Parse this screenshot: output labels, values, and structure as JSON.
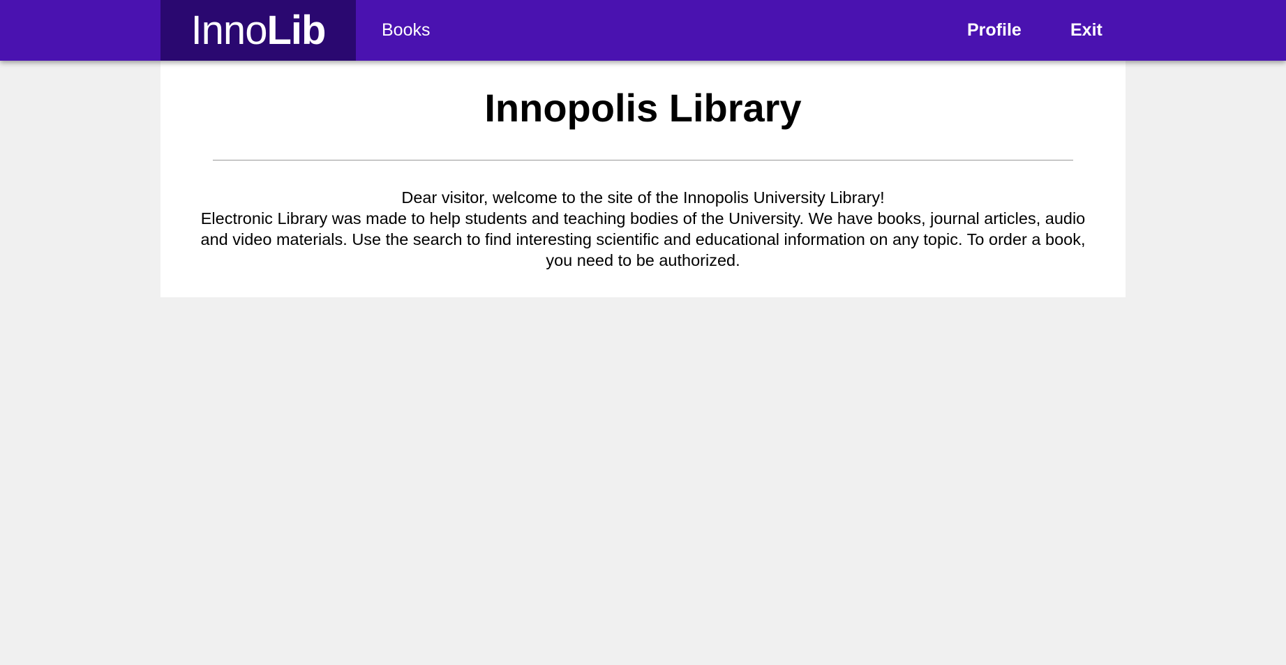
{
  "navbar": {
    "brand_light": "Inno",
    "brand_bold": "Lib",
    "books_label": "Books",
    "profile_label": "Profile",
    "exit_label": "Exit",
    "colors": {
      "bar": "#4a12b0",
      "brand_bg": "#2a0870",
      "text": "#ffffff"
    }
  },
  "main": {
    "title": "Innopolis Library",
    "greeting": "Dear visitor, welcome to the site of the Innopolis University Library!",
    "description": "Electronic Library was made to help students and teaching bodies of the University. We have books, journal articles, audio and video materials. Use the search to find interesting scientific and educational information on any topic. To order a book, you need to be authorized."
  },
  "page": {
    "background": "#f0f0f0",
    "card_background": "#ffffff"
  }
}
